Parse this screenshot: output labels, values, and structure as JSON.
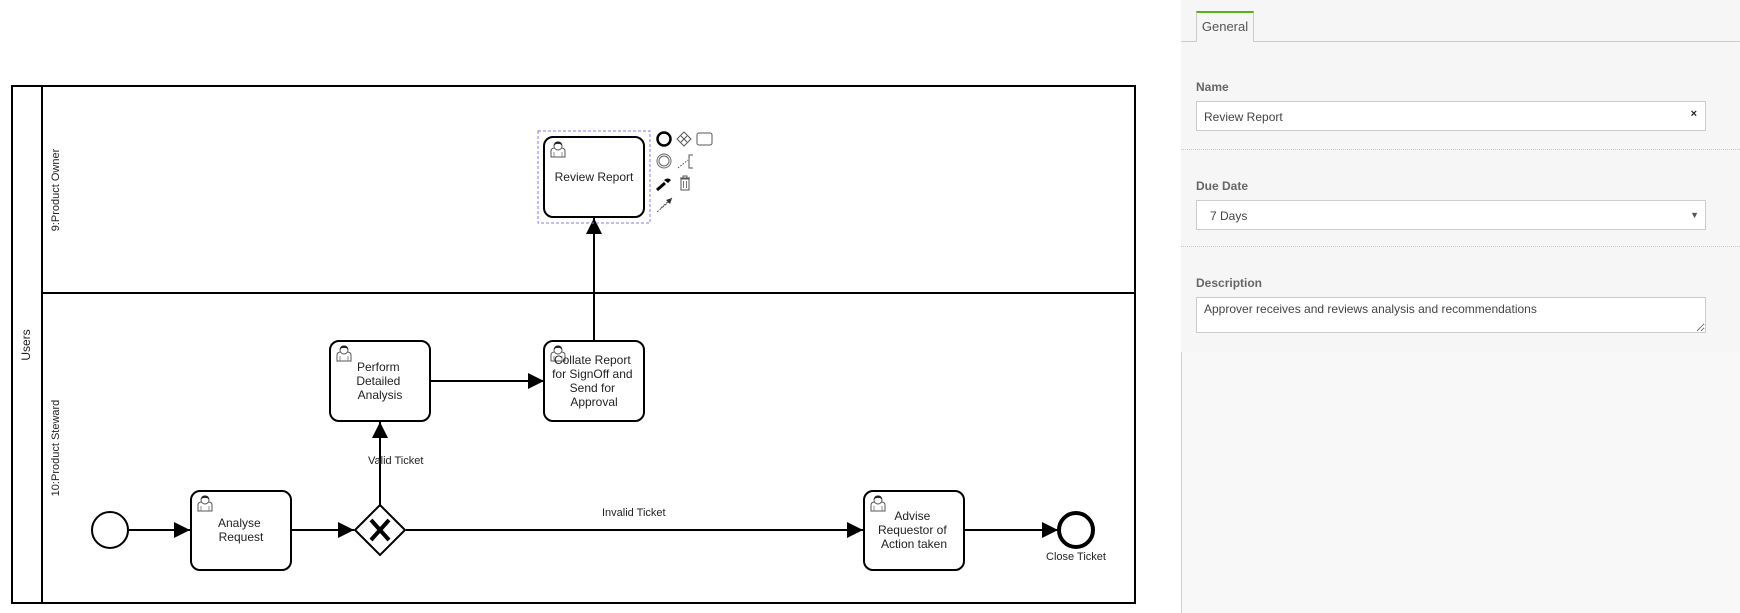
{
  "diagram": {
    "pool": {
      "label": "Users"
    },
    "lanes": [
      {
        "id": "lane-product-owner",
        "label": "9:Product Owner"
      },
      {
        "id": "lane-product-steward",
        "label": "10:Product Steward"
      }
    ],
    "start_event": {
      "type": "start-event"
    },
    "tasks": [
      {
        "id": "analyse-request",
        "lines": [
          "Analyse",
          "Request"
        ],
        "type": "user-task"
      },
      {
        "id": "perform-detailed-analysis",
        "lines": [
          "Perform",
          "Detailed",
          "Analysis"
        ],
        "type": "user-task"
      },
      {
        "id": "collate-report",
        "lines": [
          "Collate Report",
          "for SignOff and",
          "Send for",
          "Approval"
        ],
        "type": "user-task"
      },
      {
        "id": "review-report",
        "lines": [
          "Review Report"
        ],
        "type": "user-task",
        "selected": true
      },
      {
        "id": "advise-requestor",
        "lines": [
          "Advise",
          "Requestor of",
          "Action taken"
        ],
        "type": "user-task"
      }
    ],
    "gateway": {
      "type": "exclusive-gateway"
    },
    "end_event": {
      "label": "Close Ticket"
    },
    "flow_labels": {
      "valid": "Valid Ticket",
      "invalid": "Invalid Ticket"
    },
    "context_pad": [
      "append-end-event-icon",
      "append-gateway-icon",
      "append-task-icon",
      "append-intermediate-event-icon",
      "text-annotation-icon",
      "change-type-wrench-icon",
      "delete-trash-icon",
      "connect-arrow-icon"
    ],
    "colors": {
      "selection": "#8878e8",
      "stroke": "#000000"
    }
  },
  "panel": {
    "tabs": [
      {
        "label": "General",
        "active": true
      }
    ],
    "fields": {
      "name": {
        "label": "Name",
        "value": "Review Report",
        "clear": "×"
      },
      "due_date": {
        "label": "Due Date",
        "value": "7 Days",
        "arrow": "▼"
      },
      "description": {
        "label": "Description",
        "value": "Approver receives and reviews analysis and recommendations"
      }
    },
    "colors": {
      "tab_accent": "#52b415"
    }
  }
}
